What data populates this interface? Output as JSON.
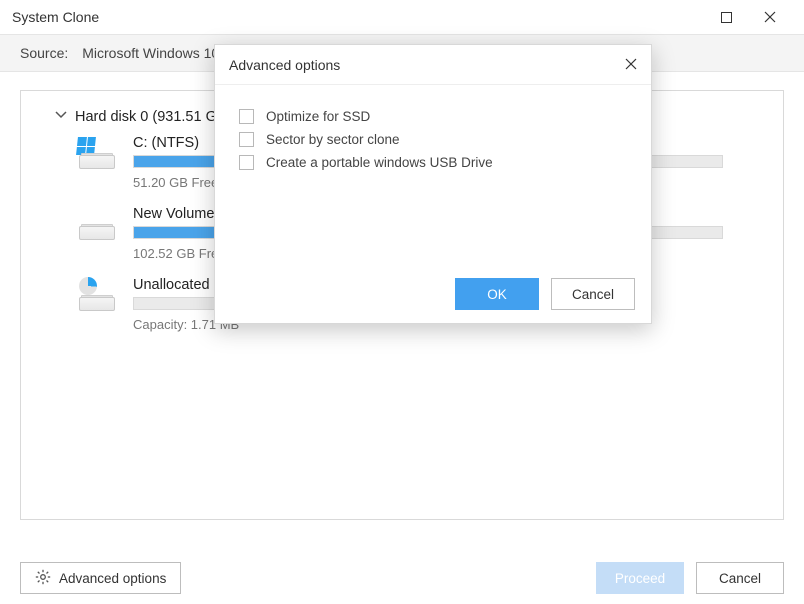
{
  "window": {
    "title": "System Clone"
  },
  "source": {
    "label": "Source:",
    "value": "Microsoft Windows 10"
  },
  "disk": {
    "name": "Hard disk 0 (931.51 GB)"
  },
  "partitions": [
    {
      "name": "C: (NTFS)",
      "sub": "51.20 GB Free of 100.00 GB",
      "fill_pct": 48,
      "icon": "windows"
    },
    {
      "name": "New Volume (NTFS)",
      "sub": "102.52 GB Free of 200.00 GB",
      "fill_pct": 49,
      "icon": "plain"
    },
    {
      "name": "Unallocated",
      "sub": "Capacity: 1.71 MB",
      "fill_pct": 0,
      "icon": "pie"
    }
  ],
  "footer": {
    "advanced": "Advanced options",
    "proceed": "Proceed",
    "cancel": "Cancel"
  },
  "dialog": {
    "title": "Advanced options",
    "options": [
      "Optimize for SSD",
      "Sector by sector clone",
      "Create a portable windows USB Drive"
    ],
    "ok": "OK",
    "cancel": "Cancel"
  }
}
